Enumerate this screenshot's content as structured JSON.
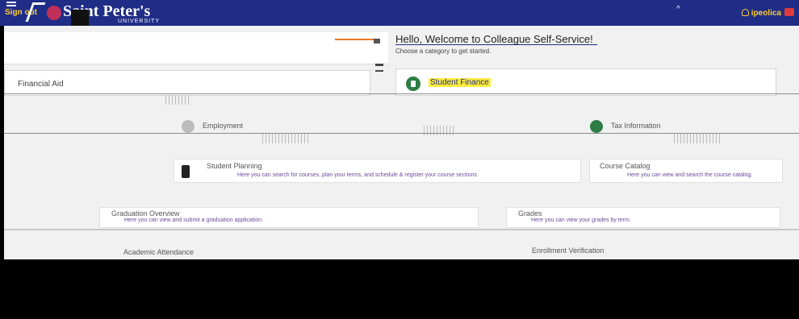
{
  "header": {
    "signout_label": "Sign out",
    "logo_name": "Saint Peter's",
    "logo_sub": "UNIVERSITY",
    "notification_glyph": "^",
    "user_label": "ipeolica",
    "brand_color": "#1f2d86",
    "accent_color": "#ffcc33"
  },
  "welcome": {
    "greeting": "Hello, Welcome to Colleague Self-Service!",
    "subtitle": "Choose a category to get started."
  },
  "cards": {
    "financial_aid": {
      "title": "Financial Aid"
    },
    "student_finance": {
      "title": "Student Finance"
    }
  },
  "tiles": {
    "employment": {
      "title": "Employment"
    },
    "tax_information": {
      "title": "Tax Information"
    },
    "student_planning": {
      "title": "Student Planning",
      "desc": "Here you can search for courses, plan your terms, and schedule & register your course sections."
    },
    "course_catalog": {
      "title": "Course Catalog",
      "desc": "Here you can view and search the course catalog."
    },
    "graduation": {
      "title": "Graduation Overview",
      "desc": "Here you can view and submit a graduation application."
    },
    "grades": {
      "title": "Grades",
      "desc": "Here you can view your grades by term."
    },
    "academic_attendance": {
      "title": "Academic Attendance"
    },
    "enrollment_verification": {
      "title": "Enrollment Verification"
    }
  },
  "icons": {
    "menu": "hamburger-icon",
    "bank": "bank-icon",
    "card": "document-icon",
    "user": "person-icon",
    "signout": "signout-icon"
  }
}
